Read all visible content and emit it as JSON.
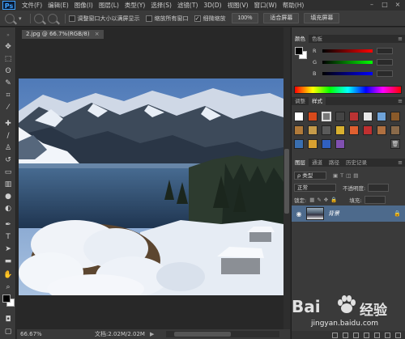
{
  "app": {
    "logo": "Ps"
  },
  "menu": [
    "文件(F)",
    "编辑(E)",
    "图像(I)",
    "图层(L)",
    "类型(Y)",
    "选择(S)",
    "滤镜(T)",
    "3D(D)",
    "视图(V)",
    "窗口(W)",
    "帮助(H)"
  ],
  "options": {
    "resize_windows_label": "调整窗口大小以满屏显示",
    "zoom_all_label": "缩放所有窗口",
    "scrubby_zoom_label": "细微缩放",
    "scrubby_zoom_checked": true,
    "btn_100": "100%",
    "btn_fit": "适合屏幕",
    "btn_fill": "填充屏幕"
  },
  "document": {
    "tab_title": "2.jpg @ 66.7%(RGB/8)",
    "close": "×"
  },
  "status": {
    "zoom": "66.67%",
    "doc_size": "文档:2.02M/2.02M",
    "arrow": "▶"
  },
  "panels": {
    "color_tabs": [
      "颜色",
      "色板"
    ],
    "slider_labels": [
      "R",
      "G",
      "B"
    ],
    "adjust_tabs": [
      "调整",
      "样式"
    ],
    "layers_tabs": [
      "图层",
      "通道",
      "路径",
      "历史记录"
    ],
    "kind_label": "ρ 类型",
    "blend_mode": "正常",
    "opacity_label": "不透明度:",
    "lock_label": "锁定:",
    "fill_label": "填充:",
    "layer_name": "背景",
    "menu_icon": "≡"
  },
  "colors": {
    "foreground": "#000000",
    "background": "#ffffff",
    "selected_layer": "#4d6a8c"
  },
  "watermark": {
    "brand": "Bai",
    "brand_cn": "经验",
    "url": "jingyan.baidu.com"
  }
}
